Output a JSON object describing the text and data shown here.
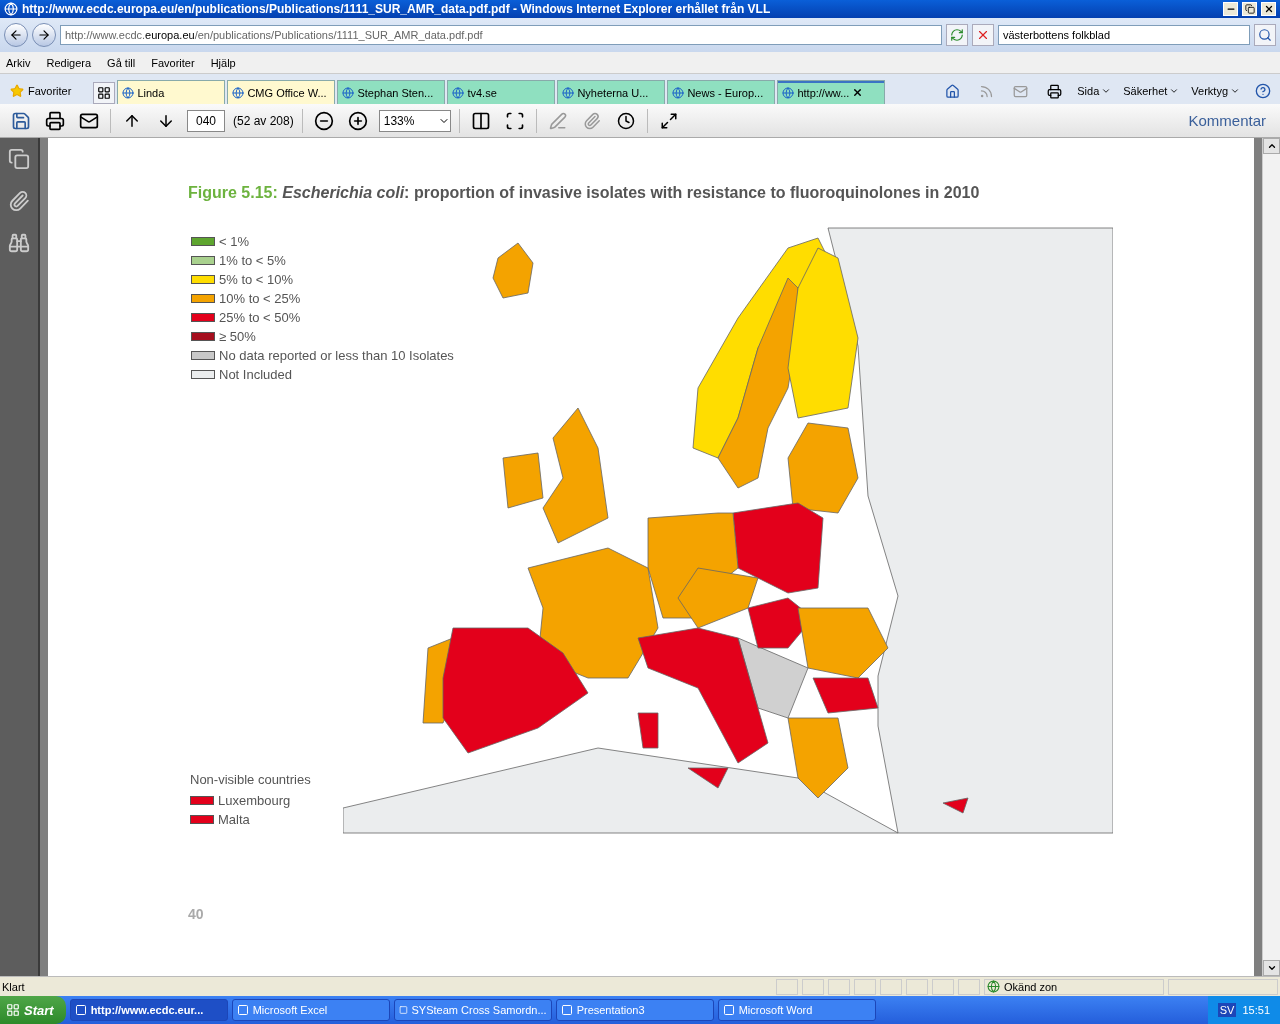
{
  "window": {
    "title": "http://www.ecdc.europa.eu/en/publications/Publications/1111_SUR_AMR_data.pdf.pdf - Windows Internet Explorer erhållet från VLL"
  },
  "address_bar": {
    "url": "http://www.ecdc.**europa.eu**/en/publications/Publications/1111_SUR_AMR_data.pdf.pdf"
  },
  "search": {
    "value": "västerbottens folkblad"
  },
  "menu": [
    "Arkiv",
    "Redigera",
    "Gå till",
    "Favoriter",
    "Hjälp"
  ],
  "favorites_label": "Favoriter",
  "tabs": [
    {
      "label": "Linda",
      "selected": false,
      "color": "#fff9cf"
    },
    {
      "label": "CMG Office W...",
      "selected": false,
      "color": "#fff9cf"
    },
    {
      "label": "Stephan Sten...",
      "selected": false,
      "color": "#8fe0c0"
    },
    {
      "label": "tv4.se",
      "selected": false,
      "color": "#8fe0c0"
    },
    {
      "label": "Nyheterna U...",
      "selected": false,
      "color": "#8fe0c0"
    },
    {
      "label": "News - Europ...",
      "selected": false,
      "color": "#8fe0c0"
    },
    {
      "label": "http://ww...",
      "selected": true,
      "color": "#8fe0c0"
    }
  ],
  "command_bar": [
    "Sida",
    "Säkerhet",
    "Verktyg"
  ],
  "pdf_toolbar": {
    "page": "040",
    "page_count": "(52 av 208)",
    "zoom": "133%",
    "comment": "Kommentar"
  },
  "figure": {
    "label": "Figure 5.15:",
    "title": "*Escherichia coli*: proportion of invasive isolates with resistance to fluoroquinolones in 2010",
    "legend": [
      {
        "label": "< 1%",
        "color": "#5ea52f"
      },
      {
        "label": "1% to < 5%",
        "color": "#a9d18e"
      },
      {
        "label": "5% to < 10%",
        "color": "#ffdd00"
      },
      {
        "label": "10% to < 25%",
        "color": "#f4a300"
      },
      {
        "label": "25% to < 50%",
        "color": "#e3001b"
      },
      {
        "label": "≥ 50%",
        "color": "#a50e1e"
      },
      {
        "label": "No data reported or less than 10 Isolates",
        "color": "#c8c8c8"
      },
      {
        "label": "Not Included",
        "color": "#ebedee"
      }
    ],
    "non_visible": {
      "title": "Non-visible countries",
      "items": [
        {
          "label": "Luxembourg",
          "color": "#e3001b"
        },
        {
          "label": "Malta",
          "color": "#e3001b"
        }
      ]
    }
  },
  "page_number": "40",
  "status_bar": {
    "text": "Klart",
    "zone": "Okänd zon"
  },
  "taskbar": {
    "start": "Start",
    "tasks": [
      {
        "label": "http://www.ecdc.eur...",
        "selected": true
      },
      {
        "label": "Microsoft Excel",
        "selected": false
      },
      {
        "label": "SYSteam Cross Samordn...",
        "selected": false
      },
      {
        "label": "Presentation3",
        "selected": false
      },
      {
        "label": "Microsoft Word",
        "selected": false
      }
    ],
    "language": "SV",
    "clock": "15:51"
  }
}
